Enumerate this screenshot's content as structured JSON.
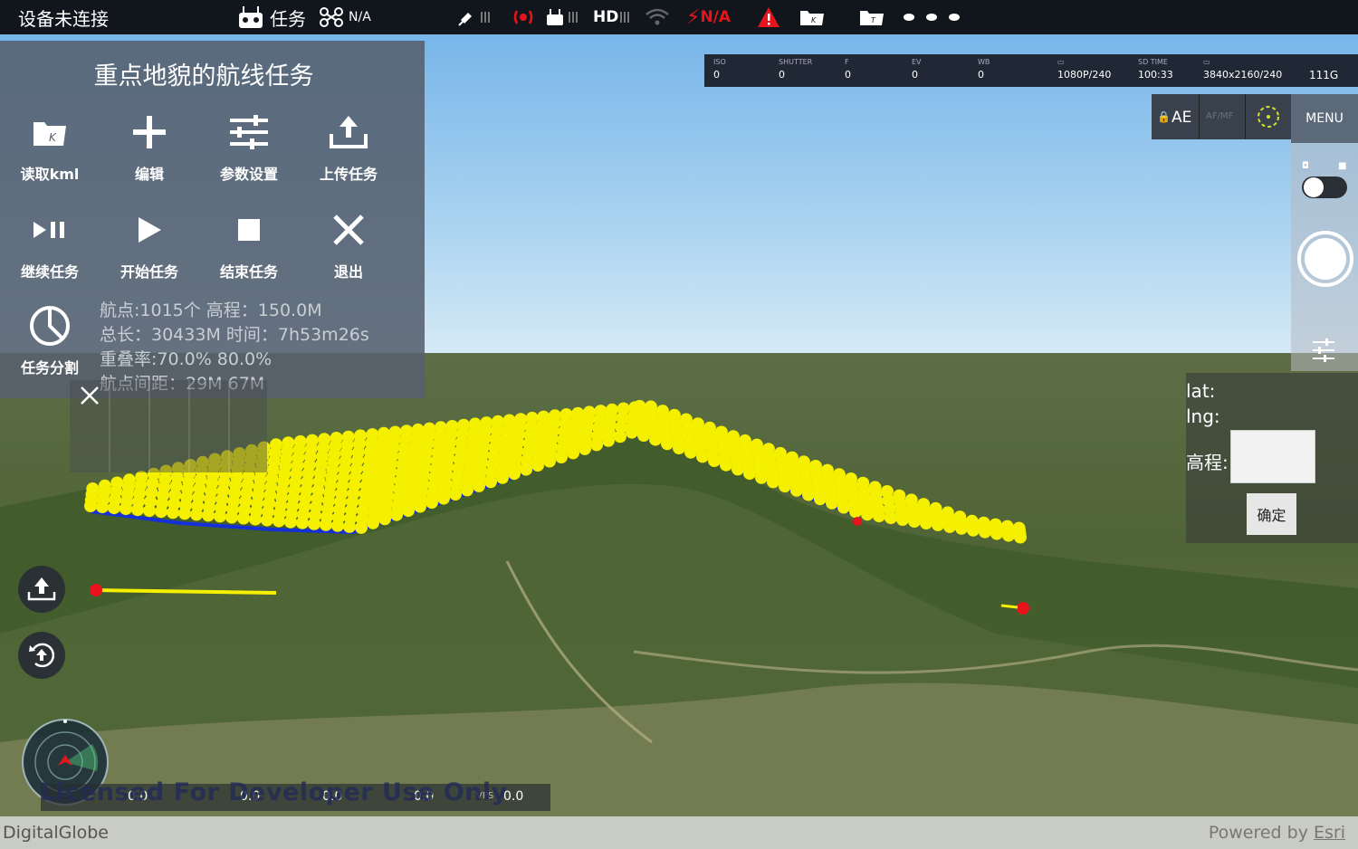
{
  "status_bar": {
    "connection": "设备未连接",
    "mode": "任务",
    "aircraft_status": "N/A",
    "hd_label": "HD",
    "battery_status": "N/A"
  },
  "panel": {
    "title": "重点地貌的航线任务",
    "tools": [
      {
        "label": "读取kml",
        "icon": "folder-kml-icon"
      },
      {
        "label": "编辑",
        "icon": "plus-icon"
      },
      {
        "label": "参数设置",
        "icon": "sliders-icon"
      },
      {
        "label": "上传任务",
        "icon": "upload-icon"
      },
      {
        "label": "继续任务",
        "icon": "play-pause-icon"
      },
      {
        "label": "开始任务",
        "icon": "play-icon"
      },
      {
        "label": "结束任务",
        "icon": "stop-icon"
      },
      {
        "label": "退出",
        "icon": "close-icon"
      },
      {
        "label": "任务分割",
        "icon": "pie-icon"
      }
    ],
    "info": {
      "line1": "航点:1015个  高程：150.0M",
      "line2": "总长：30433M 时间：7h53m26s",
      "line3": "重叠率:70.0% 80.0%",
      "line4": "航点间距：29M 67M"
    }
  },
  "camera": {
    "iso_label": "ISO",
    "iso": "0",
    "shutter_label": "SHUTTER",
    "shutter": "0",
    "f_label": "F",
    "f": "0",
    "ev_label": "EV",
    "ev": "0",
    "wb_label": "WB",
    "wb": "0",
    "video": "1080P/240",
    "sd_time_label": "SD TIME",
    "sd_time": "100:33",
    "photo": "3840x2160/240",
    "storage": "111G"
  },
  "right": {
    "ae": "AE",
    "af_mf": "AF/MF",
    "menu": "MENU"
  },
  "coord": {
    "lat_label": "lat:",
    "lng_label": "lng:",
    "elev_label": "高程:",
    "confirm": "确定"
  },
  "telemetry": {
    "d": "0.0",
    "h": "0.0",
    "hs": "0.0",
    "vs": "0.0",
    "vps_label": "VPS",
    "vps": "0.0"
  },
  "watermark": "Licensed For Developer Use Only",
  "attribution_left": "DigitalGlobe",
  "attribution_right_prefix": "Powered by ",
  "attribution_right_brand": "Esri",
  "colors": {
    "route_points": "#f5ef00",
    "route_outline": "#1530d8",
    "marker": "#e8141c",
    "panel_bg": "#55606e"
  }
}
